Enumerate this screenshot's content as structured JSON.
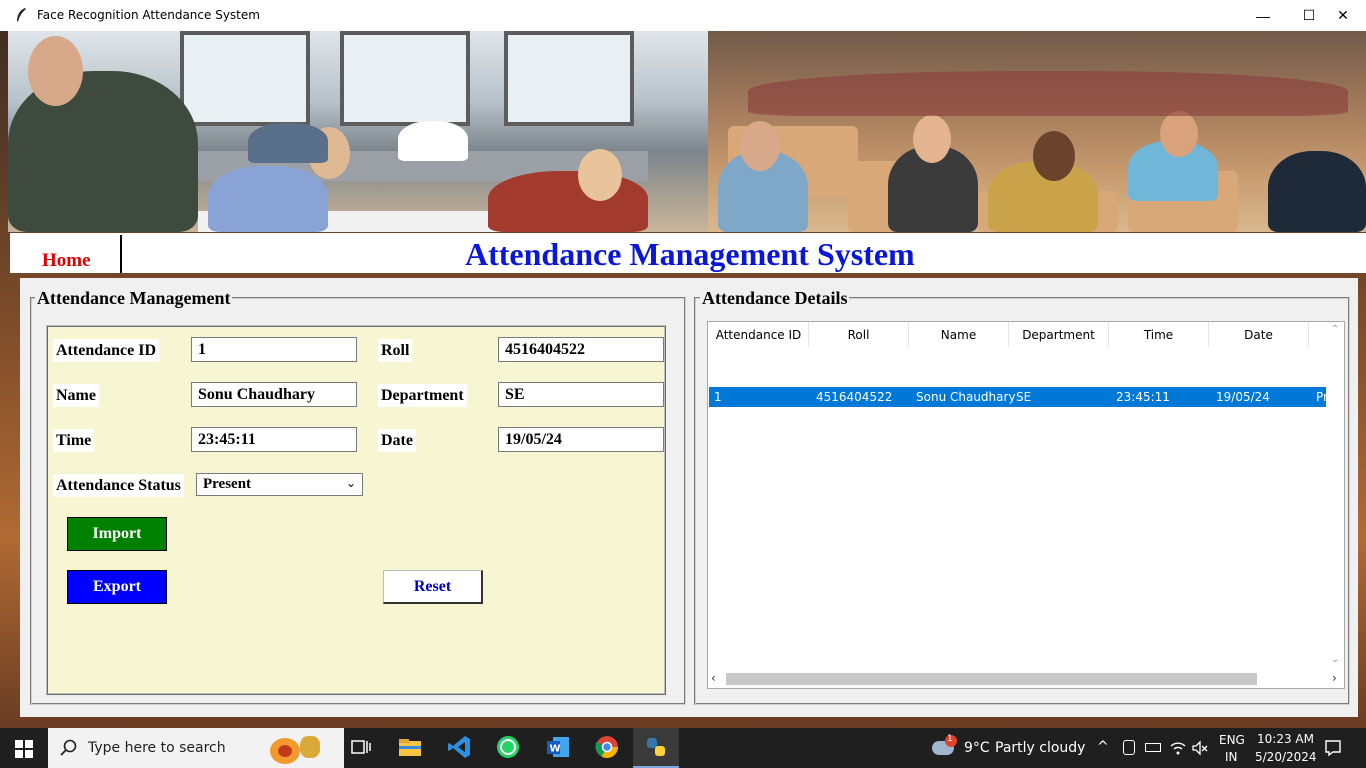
{
  "window": {
    "title": "Face Recognition Attendance System",
    "controls": {
      "minimize": "—",
      "maximize": "☐",
      "close": "✕"
    }
  },
  "header": {
    "home_label": "Home",
    "title": "Attendance Management System"
  },
  "management": {
    "frame_title": "Attendance Management",
    "fields": {
      "attendance_id": {
        "label": "Attendance ID",
        "value": "1"
      },
      "roll": {
        "label": "Roll",
        "value": "4516404522"
      },
      "name": {
        "label": "Name",
        "value": "Sonu Chaudhary"
      },
      "department": {
        "label": "Department",
        "value": "SE"
      },
      "time": {
        "label": "Time",
        "value": "23:45:11"
      },
      "date": {
        "label": "Date",
        "value": "19/05/24"
      },
      "status": {
        "label": "Attendance Status",
        "value": "Present"
      }
    },
    "buttons": {
      "import": "Import",
      "export": "Export",
      "reset": "Reset"
    },
    "colors": {
      "import": "#008000",
      "export": "#0000ff",
      "panel": "#f7f5d2"
    }
  },
  "details": {
    "frame_title": "Attendance Details",
    "columns": [
      "Attendance ID",
      "Roll",
      "Name",
      "Department",
      "Time",
      "Date"
    ],
    "rows": [
      {
        "id": "1",
        "roll": "4516404522",
        "name": "Sonu Chaudhary",
        "department": "SE",
        "time": "23:45:11",
        "date": "19/05/24",
        "status": "Pr"
      }
    ],
    "selected_row_color": "#0078d7"
  },
  "taskbar": {
    "search_placeholder": "Type here to search",
    "weather_temp": "9°C",
    "weather_desc": "Partly cloudy",
    "weather_badge": "1",
    "lang_top": "ENG",
    "lang_bottom": "IN",
    "time": "10:23 AM",
    "date": "5/20/2024",
    "apps": [
      "task-view-icon",
      "file-explorer-icon",
      "vscode-icon",
      "whatsapp-icon",
      "word-icon",
      "chrome-icon",
      "python-icon"
    ]
  }
}
